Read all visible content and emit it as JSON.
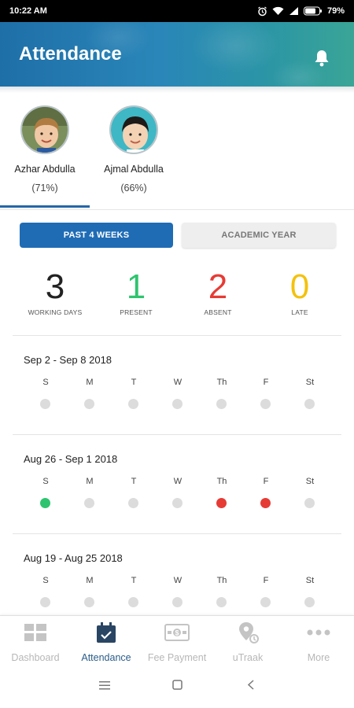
{
  "status_bar": {
    "time": "10:22 AM",
    "battery": "79%"
  },
  "header": {
    "title": "Attendance"
  },
  "students": [
    {
      "name": "Azhar Abdulla",
      "percent": "(71%)"
    },
    {
      "name": "Ajmal Abdulla",
      "percent": "(66%)"
    }
  ],
  "toggle": {
    "active": "PAST 4 WEEKS",
    "inactive": "ACADEMIC YEAR"
  },
  "stats": [
    {
      "value": "3",
      "label": "WORKING DAYS",
      "color": "#222222"
    },
    {
      "value": "1",
      "label": "PRESENT",
      "color": "#2ec46f"
    },
    {
      "value": "2",
      "label": "ABSENT",
      "color": "#e63b35"
    },
    {
      "value": "0",
      "label": "LATE",
      "color": "#f4c20d"
    }
  ],
  "days": [
    "S",
    "M",
    "T",
    "W",
    "Th",
    "F",
    "St"
  ],
  "weeks": [
    {
      "title": "Sep 2 - Sep 8 2018",
      "status": [
        "none",
        "none",
        "none",
        "none",
        "none",
        "none",
        "none"
      ]
    },
    {
      "title": "Aug 26 - Sep 1 2018",
      "status": [
        "present",
        "none",
        "none",
        "none",
        "absent",
        "absent",
        "none"
      ]
    },
    {
      "title": "Aug 19 - Aug 25 2018",
      "status": [
        "none",
        "none",
        "none",
        "none",
        "none",
        "none",
        "none"
      ]
    }
  ],
  "nav": [
    {
      "label": "Dashboard",
      "icon": "dashboard-icon"
    },
    {
      "label": "Attendance",
      "icon": "attendance-icon",
      "active": true
    },
    {
      "label": "Fee Payment",
      "icon": "fee-payment-icon"
    },
    {
      "label": "uTraak",
      "icon": "utraak-icon"
    },
    {
      "label": "More",
      "icon": "more-icon"
    }
  ],
  "colors": {
    "accent": "#1f6cb5",
    "present": "#2ec46f",
    "absent": "#e63b35",
    "late": "#f4c20d"
  }
}
